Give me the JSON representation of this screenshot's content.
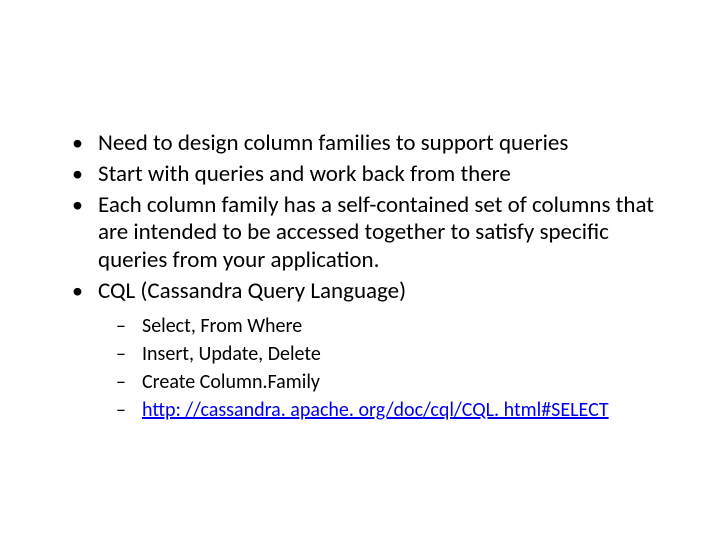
{
  "bullets": {
    "b1": "Need to design column families to support queries",
    "b2": "Start with queries and work back from there",
    "b3": "Each column family has a self-contained set of columns that are intended to be accessed together to satisfy specific queries from your application.",
    "b4": "CQL (Cassandra Query Language)",
    "sub": {
      "s1": "Select, From Where",
      "s2": "Insert, Update, Delete",
      "s3": "Create Column.Family",
      "s4": "http: //cassandra. apache. org/doc/cql/CQL. html#SELECT"
    }
  }
}
